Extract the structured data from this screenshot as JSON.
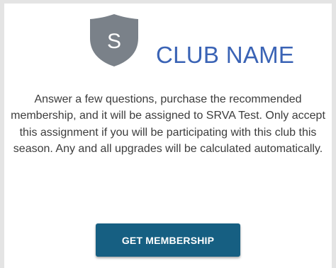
{
  "logo": {
    "icon": "shield-icon",
    "letter": "S",
    "color": "#7a8189"
  },
  "club_name": "CLUB NAME",
  "description": "Answer a few questions, purchase the recommended membership, and it will be assigned to SRVA Test. Only accept this assignment if you will be participating with this club this season. Any and all upgrades will be calculated automatically.",
  "cta": {
    "label": "GET MEMBERSHIP",
    "color": "#165f82"
  },
  "colors": {
    "club_name": "#3a63b5",
    "text": "#3c3c3c",
    "page_background": "#e4e4e4",
    "card_background": "#ffffff"
  }
}
